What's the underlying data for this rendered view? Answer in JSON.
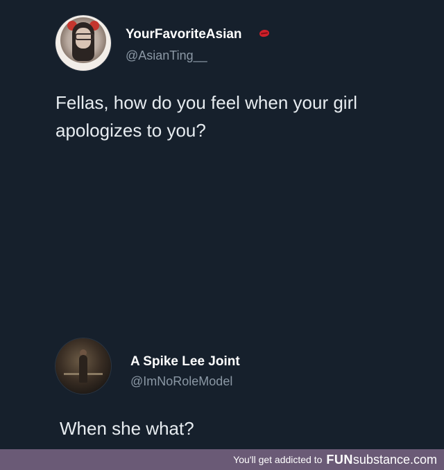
{
  "tweet1": {
    "display_name": "YourFavoriteAsian",
    "handle": "@AsianTing__",
    "badge_icon": "lips-icon",
    "text": "Fellas, how do you feel when your girl apologizes to you?"
  },
  "tweet2": {
    "display_name": "A Spike Lee Joint",
    "handle": "@ImNoRoleModel",
    "text": "When she what?"
  },
  "footer": {
    "tagline": "You'll get addicted to",
    "logo_fun": "FUN",
    "logo_substance": "substance",
    "logo_com": ".com"
  },
  "colors": {
    "background": "#16202c",
    "footer_background": "#6a5a76",
    "handle": "#8b98a5",
    "badge": "#d0202a"
  }
}
